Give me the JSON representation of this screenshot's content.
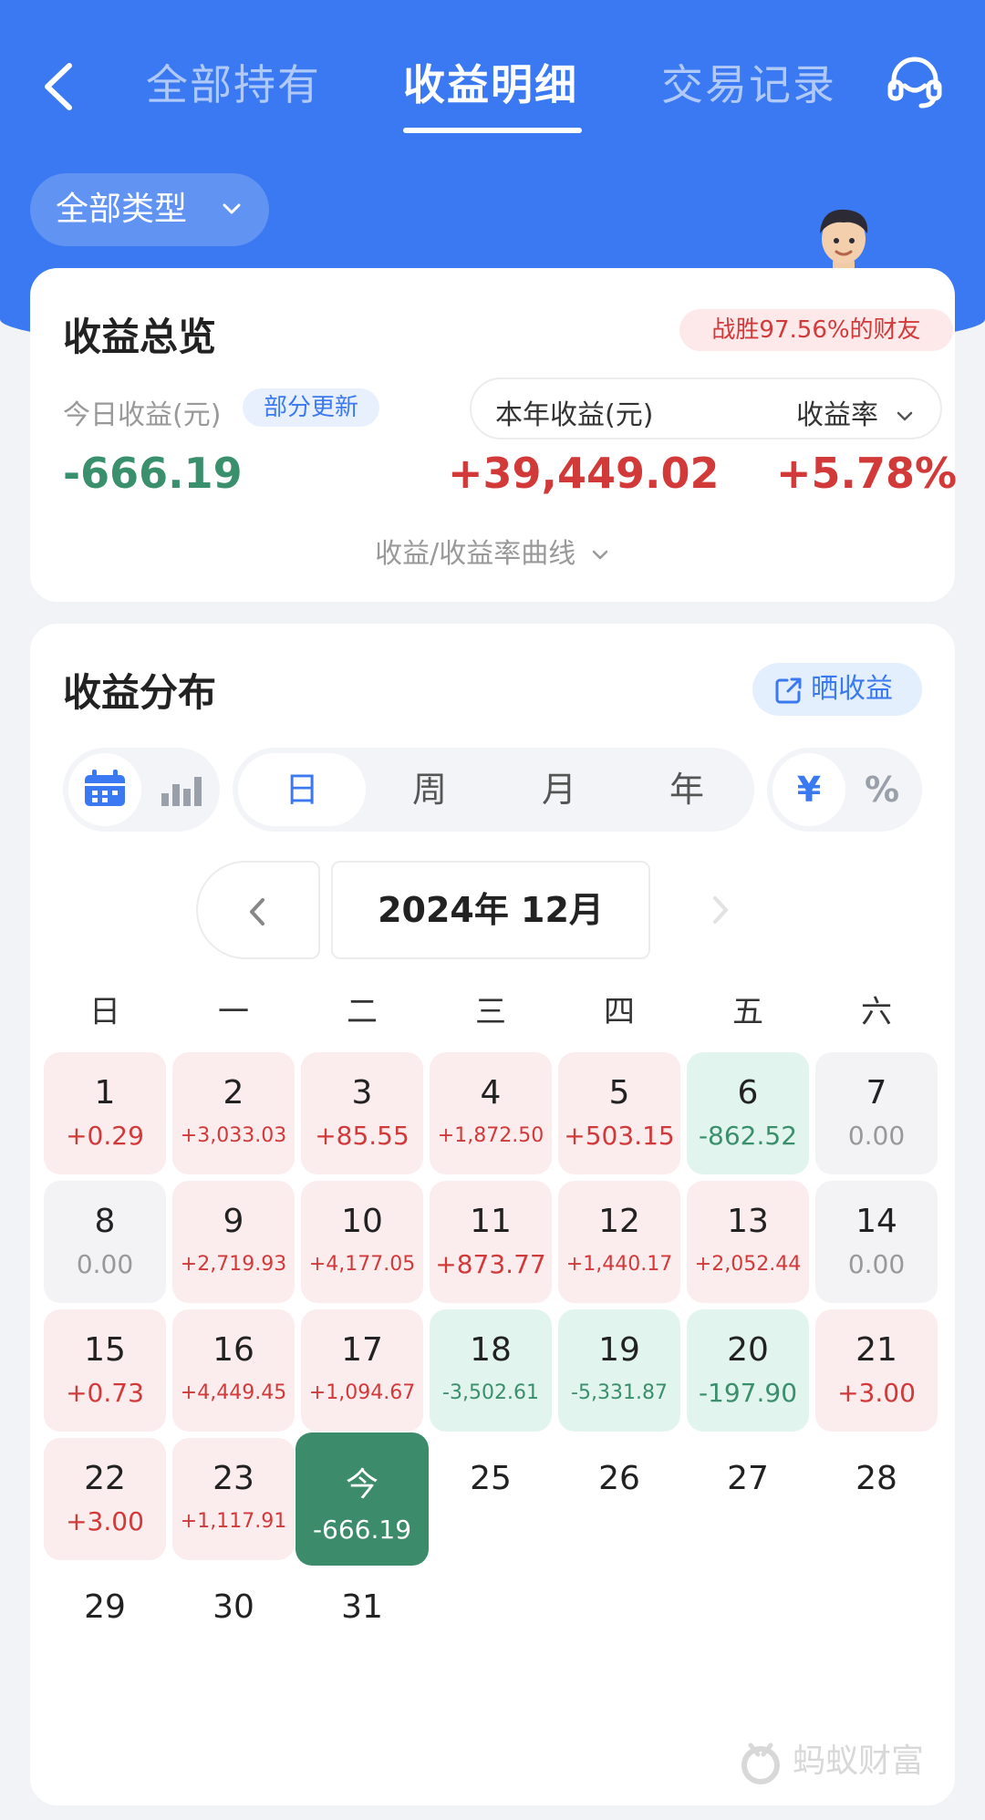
{
  "header": {
    "tabs": [
      {
        "label": "全部持有"
      },
      {
        "label": "收益明细"
      },
      {
        "label": "交易记录"
      }
    ],
    "filter_label": "全部类型"
  },
  "overview": {
    "title": "收益总览",
    "rank_badge": "战胜97.56%的财友",
    "today_label": "今日收益(元)",
    "update_tag": "部分更新",
    "today_value": "-666.19",
    "year_label": "本年收益(元)",
    "rate_select": "收益率",
    "year_value": "+39,449.02",
    "rate_value": "+5.78%",
    "curve_link": "收益/收益率曲线"
  },
  "distribution": {
    "title": "收益分布",
    "share_label": "晒收益",
    "period_tabs": [
      {
        "label": "日"
      },
      {
        "label": "周"
      },
      {
        "label": "月"
      },
      {
        "label": "年"
      }
    ],
    "unit_options": {
      "currency": "¥",
      "percent": "%"
    },
    "month_label": "2024年 12月",
    "weekdays": [
      "日",
      "一",
      "二",
      "三",
      "四",
      "五",
      "六"
    ],
    "days": [
      {
        "d": "1",
        "v": "+0.29"
      },
      {
        "d": "2",
        "v": "+3,033.03"
      },
      {
        "d": "3",
        "v": "+85.55"
      },
      {
        "d": "4",
        "v": "+1,872.50"
      },
      {
        "d": "5",
        "v": "+503.15"
      },
      {
        "d": "6",
        "v": "-862.52"
      },
      {
        "d": "7",
        "v": "0.00"
      },
      {
        "d": "8",
        "v": "0.00"
      },
      {
        "d": "9",
        "v": "+2,719.93"
      },
      {
        "d": "10",
        "v": "+4,177.05"
      },
      {
        "d": "11",
        "v": "+873.77"
      },
      {
        "d": "12",
        "v": "+1,440.17"
      },
      {
        "d": "13",
        "v": "+2,052.44"
      },
      {
        "d": "14",
        "v": "0.00"
      },
      {
        "d": "15",
        "v": "+0.73"
      },
      {
        "d": "16",
        "v": "+4,449.45"
      },
      {
        "d": "17",
        "v": "+1,094.67"
      },
      {
        "d": "18",
        "v": "-3,502.61"
      },
      {
        "d": "19",
        "v": "-5,331.87"
      },
      {
        "d": "20",
        "v": "-197.90"
      },
      {
        "d": "21",
        "v": "+3.00"
      },
      {
        "d": "22",
        "v": "+3.00"
      },
      {
        "d": "23",
        "v": "+1,117.91"
      },
      {
        "d": "今",
        "v": "-666.19"
      },
      {
        "d": "25",
        "v": ""
      },
      {
        "d": "26",
        "v": ""
      },
      {
        "d": "27",
        "v": ""
      },
      {
        "d": "28",
        "v": ""
      },
      {
        "d": "29",
        "v": ""
      },
      {
        "d": "30",
        "v": ""
      },
      {
        "d": "31",
        "v": ""
      }
    ]
  },
  "brand": "蚂蚁财富",
  "colors": {
    "header_blue": "#3a79f1",
    "gain_red": "#d23a3a",
    "loss_green": "#3a8f6d",
    "today_green": "#3c8c6b"
  },
  "icons": [
    "back-arrow-icon",
    "headset-icon",
    "chevron-down-icon",
    "calendar-icon",
    "bar-chart-icon",
    "share-icon",
    "chevron-left-icon",
    "chevron-right-icon",
    "ant-logo-icon"
  ]
}
